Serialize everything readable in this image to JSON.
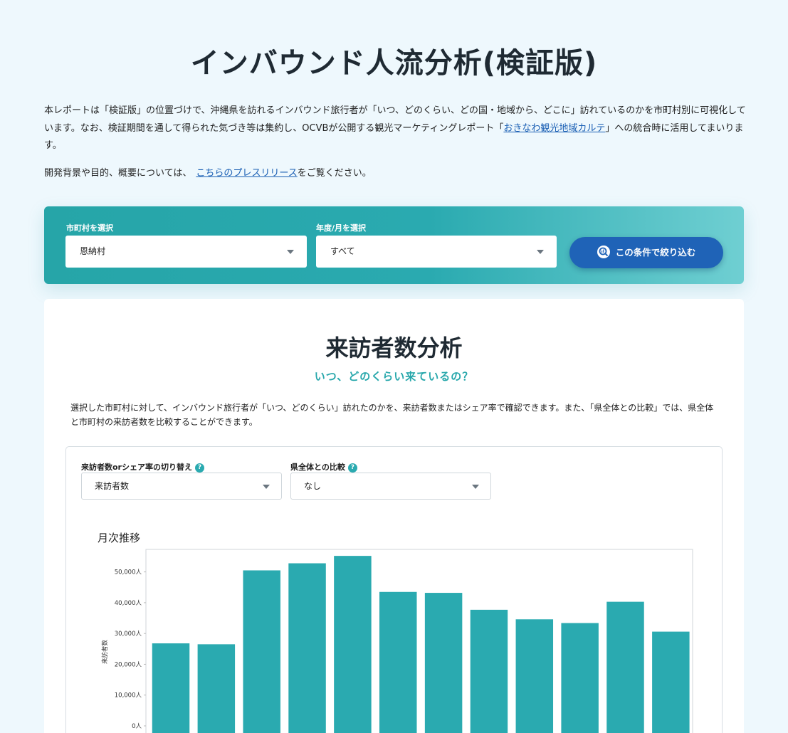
{
  "page_title": "インバウンド人流分析(検証版)",
  "intro": {
    "text_before": "本レポートは「検証版」の位置づけで、沖縄県を訪れるインバウンド旅行者が「いつ、どのくらい、どの国・地域から、どこに」訪れているのかを市町村別に可視化しています。なお、検証期間を通して得られた気づき等は集約し、OCVBが公開する観光マーケティングレポート「",
    "link_text": "おきなわ観光地域カルテ",
    "text_after": "」への統合時に活用してまいります。"
  },
  "intro2": {
    "text_before": "開発背景や目的、概要については、",
    "link_text": "こちらのプレスリリース",
    "text_after": "をご覧ください。"
  },
  "filters": {
    "municipality_label": "市町村を選択",
    "municipality_value": "恩納村",
    "period_label": "年度/月を選択",
    "period_value": "すべて",
    "submit_label": "この条件で絞り込む"
  },
  "visitors": {
    "title": "来訪者数分析",
    "subtitle": "いつ、どのくらい来ているの？",
    "description": "選択した市町村に対して、インバウンド旅行者が「いつ、どのくらい」訪れたのかを、来訪者数またはシェア率で確認できます。また、「県全体との比較」では、県全体と市町村の来訪者数を比較することができます。",
    "toggle_label": "来訪者数orシェア率の切り替え",
    "toggle_value": "来訪者数",
    "compare_label": "県全体との比較",
    "compare_value": "なし",
    "help_glyph": "?"
  },
  "colors": {
    "accent": "#2aaab0",
    "button": "#1f63b7",
    "link": "#1a5fb4"
  },
  "chart_data": {
    "type": "bar",
    "title": "月次推移",
    "ylabel": "来訪者数",
    "ylim": [
      0,
      55000
    ],
    "yticks": [
      "0人",
      "10,000人",
      "20,000人",
      "30,000人",
      "40,000人",
      "50,000人"
    ],
    "series": [
      {
        "values": [
          26800,
          26500,
          50500,
          52800,
          55200,
          43500,
          43200,
          37700,
          34600,
          33400,
          40300,
          30600
        ]
      }
    ],
    "grid": false
  }
}
